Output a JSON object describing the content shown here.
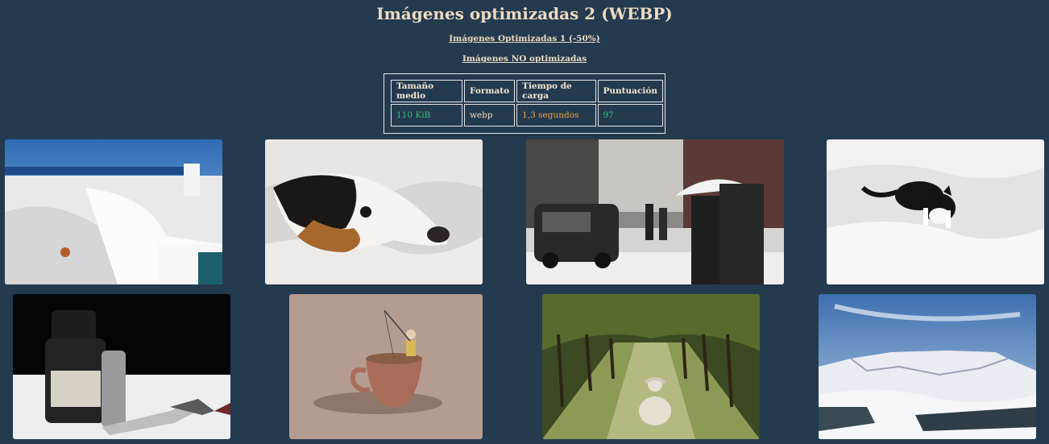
{
  "page": {
    "title": "Imágenes optimizadas 2 (WEBP)",
    "links": [
      {
        "label": "Imágenes Optimizadas 1 (-50%)"
      },
      {
        "label": "Imágenes NO optimizadas"
      }
    ]
  },
  "stats_table": {
    "headers": [
      "Tamaño medio",
      "Formato",
      "Tiempo de carga",
      "Puntuación"
    ],
    "row": [
      {
        "value": "110 KiB",
        "color": "#35c07a"
      },
      {
        "value": "webp",
        "color": "#eadbc2"
      },
      {
        "value": "1,3 segundos",
        "color": "#f0a33c"
      },
      {
        "value": "97",
        "color": "#35c07a"
      }
    ]
  },
  "gallery": [
    {
      "subject": "whitewashed-greek-house"
    },
    {
      "subject": "dog-resting-in-blanket"
    },
    {
      "subject": "snowy-city-street-umbrella"
    },
    {
      "subject": "black-white-cat-in-snow"
    },
    {
      "subject": "ink-bottle-and-dip-pen"
    },
    {
      "subject": "child-fishing-in-coffee-cup"
    },
    {
      "subject": "woman-sitting-in-orchard"
    },
    {
      "subject": "snowy-mountain-landscape"
    }
  ]
}
